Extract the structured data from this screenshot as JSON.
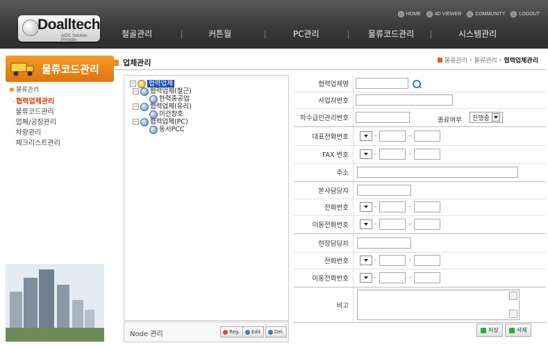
{
  "header": {
    "logo_main": "Doalltech",
    "logo_sub": "AIDC Solution Provider",
    "top_links": [
      "HOME",
      "4D VIEWER",
      "COMMUNITY",
      "LOGOUT"
    ],
    "menu": [
      "철골관리",
      "커튼월",
      "PC관리",
      "물류코드관리",
      "시스템관리"
    ]
  },
  "sidebar": {
    "title": "물류코드관리",
    "root": "물류관리",
    "items": [
      {
        "label": "협력업체관리",
        "active": true
      },
      {
        "label": "물류코드관리",
        "active": false
      },
      {
        "label": "업체/공장관리",
        "active": false
      },
      {
        "label": "차량관리",
        "active": false
      },
      {
        "label": "체크리스트관리",
        "active": false
      }
    ]
  },
  "content": {
    "title": "업체관리",
    "breadcrumb": [
      "물류관리",
      "물류관리",
      "협력업체관리"
    ]
  },
  "tree": {
    "root": "협력업체",
    "groups": [
      {
        "label": "협력업체(철근)",
        "children": [
          "한력중공업"
        ]
      },
      {
        "label": "협력업체(유리)",
        "children": [
          "이건창호"
        ]
      },
      {
        "label": "협력업체(PC)",
        "children": [
          "동서PCC"
        ]
      }
    ]
  },
  "node_bar": {
    "label": "Node 관리",
    "buttons": [
      "Reg.",
      "Edit",
      "Del."
    ]
  },
  "form": {
    "company_name_label": "협력업체명",
    "biz_no_label": "사업자번호",
    "sub_no_label": "하수급인관리번호",
    "end_label": "종료여부",
    "end_value": "진행중",
    "phone_label": "대표전화번호",
    "fax_label": "FAX 번호",
    "addr_label": "주소",
    "hq_manager_label": "본사담당자",
    "hq_phone_label": "전화번호",
    "hq_mobile_label": "이동전화번호",
    "site_manager_label": "현장담당자",
    "site_phone_label": "전화번호",
    "site_mobile_label": "이동전화번호",
    "memo_label": "비고",
    "dash": "-"
  },
  "actions": {
    "save": "저장",
    "delete": "삭제"
  }
}
